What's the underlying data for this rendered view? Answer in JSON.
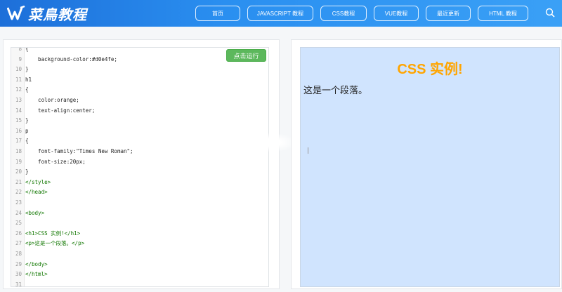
{
  "header": {
    "logo_text": "菜鳥教程",
    "nav": [
      {
        "label": "首页"
      },
      {
        "label": "JAVASCRIPT 教程"
      },
      {
        "label": "CSS教程"
      },
      {
        "label": "VUE教程"
      },
      {
        "label": "最近更新"
      },
      {
        "label": "HTML 教程"
      }
    ]
  },
  "editor": {
    "run_label": "点击运行",
    "lines": [
      {
        "n": "8",
        "t": "{"
      },
      {
        "n": "9",
        "t": "    background-color:#d0e4fe;"
      },
      {
        "n": "10",
        "t": "}"
      },
      {
        "n": "11",
        "t": "h1"
      },
      {
        "n": "12",
        "t": "{"
      },
      {
        "n": "13",
        "t": "    color:orange;"
      },
      {
        "n": "14",
        "t": "    text-align:center;"
      },
      {
        "n": "15",
        "t": "}"
      },
      {
        "n": "16",
        "t": "p"
      },
      {
        "n": "17",
        "t": "{"
      },
      {
        "n": "18",
        "t": "    font-family:\"Times New Roman\";"
      },
      {
        "n": "19",
        "t": "    font-size:20px;"
      },
      {
        "n": "20",
        "t": "}"
      },
      {
        "n": "21",
        "t": "</style>"
      },
      {
        "n": "22",
        "t": "</head>"
      },
      {
        "n": "23",
        "t": ""
      },
      {
        "n": "24",
        "t": "<body>"
      },
      {
        "n": "25",
        "t": ""
      },
      {
        "n": "26",
        "t": "<h1>CSS 实例!</h1>"
      },
      {
        "n": "27",
        "t": "<p>这是一个段落。</p>"
      },
      {
        "n": "28",
        "t": ""
      },
      {
        "n": "29",
        "t": "</body>"
      },
      {
        "n": "30",
        "t": "</html>"
      },
      {
        "n": "31",
        "t": ""
      }
    ]
  },
  "preview": {
    "h1": "CSS 实例!",
    "p": "这是一个段落。"
  }
}
